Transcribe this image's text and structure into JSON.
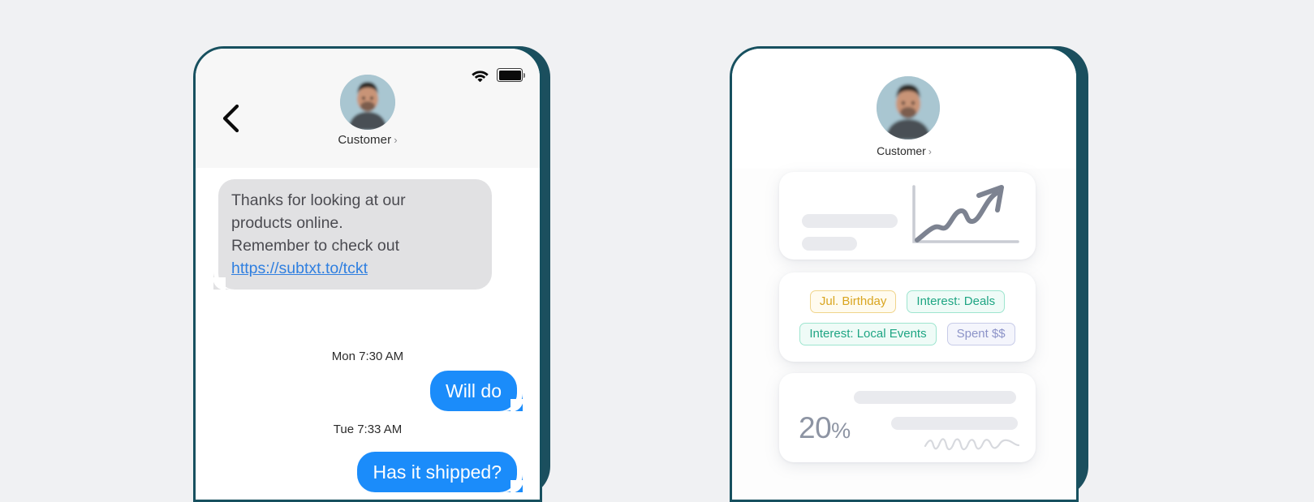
{
  "page": {
    "background_color": "#f0f1f3",
    "frame_color": "#17505f"
  },
  "left_phone": {
    "name": "messaging-app",
    "status_bar": {
      "wifi_icon": "wifi-icon",
      "battery_icon": "battery-full-icon"
    },
    "header": {
      "back_icon": "back-chevron-icon",
      "avatar_name": "customer-avatar",
      "title": "Customer",
      "disclosure_chevron": "›"
    },
    "messages": [
      {
        "direction": "incoming",
        "lines": [
          "Thanks for looking at our",
          "products online.",
          "Remember to check out"
        ],
        "link": "https://subtxt.to/tckt",
        "bubble_color": "#e1e1e3",
        "text_color": "#4b4b51",
        "link_color": "#2f7fe0"
      },
      {
        "direction": "timestamp",
        "text": "Mon 7:30 AM"
      },
      {
        "direction": "outgoing",
        "text": "Will do",
        "bubble_color": "#1b8cfa",
        "text_color": "#ffffff"
      },
      {
        "direction": "timestamp",
        "text": "Tue 7:33 AM"
      },
      {
        "direction": "outgoing",
        "text": "Has it shipped?",
        "bubble_color": "#1b8cfa",
        "text_color": "#ffffff"
      }
    ]
  },
  "right_phone": {
    "name": "customer-profile-app",
    "header": {
      "avatar_name": "customer-avatar",
      "title": "Customer",
      "disclosure_chevron": "›"
    },
    "cards": [
      {
        "name": "trend-card",
        "graphic": "upward-trend-arrow-chart",
        "placeholder_bars": 2
      },
      {
        "name": "tags-card",
        "tags": [
          {
            "label": "Jul. Birthday",
            "color": "#d9a520",
            "border": "#f0d48b",
            "background": "#fffbef",
            "style": "yellow"
          },
          {
            "label": "Interest: Deals",
            "color": "#1ea583",
            "border": "#9ee5cf",
            "background": "#effbf7",
            "style": "green"
          },
          {
            "label": "Interest: Local Events",
            "color": "#1ea583",
            "border": "#9ee5cf",
            "background": "#effbf7",
            "style": "green"
          },
          {
            "label": "Spent $$",
            "color": "#8c93c8",
            "border": "#c7cbe8",
            "background": "#f4f5fc",
            "style": "blue"
          }
        ]
      },
      {
        "name": "percent-card",
        "value": "20",
        "symbol": "%",
        "value_color": "#8d94a3",
        "graphic": "signature-squiggle",
        "placeholder_bars": 2
      }
    ]
  }
}
